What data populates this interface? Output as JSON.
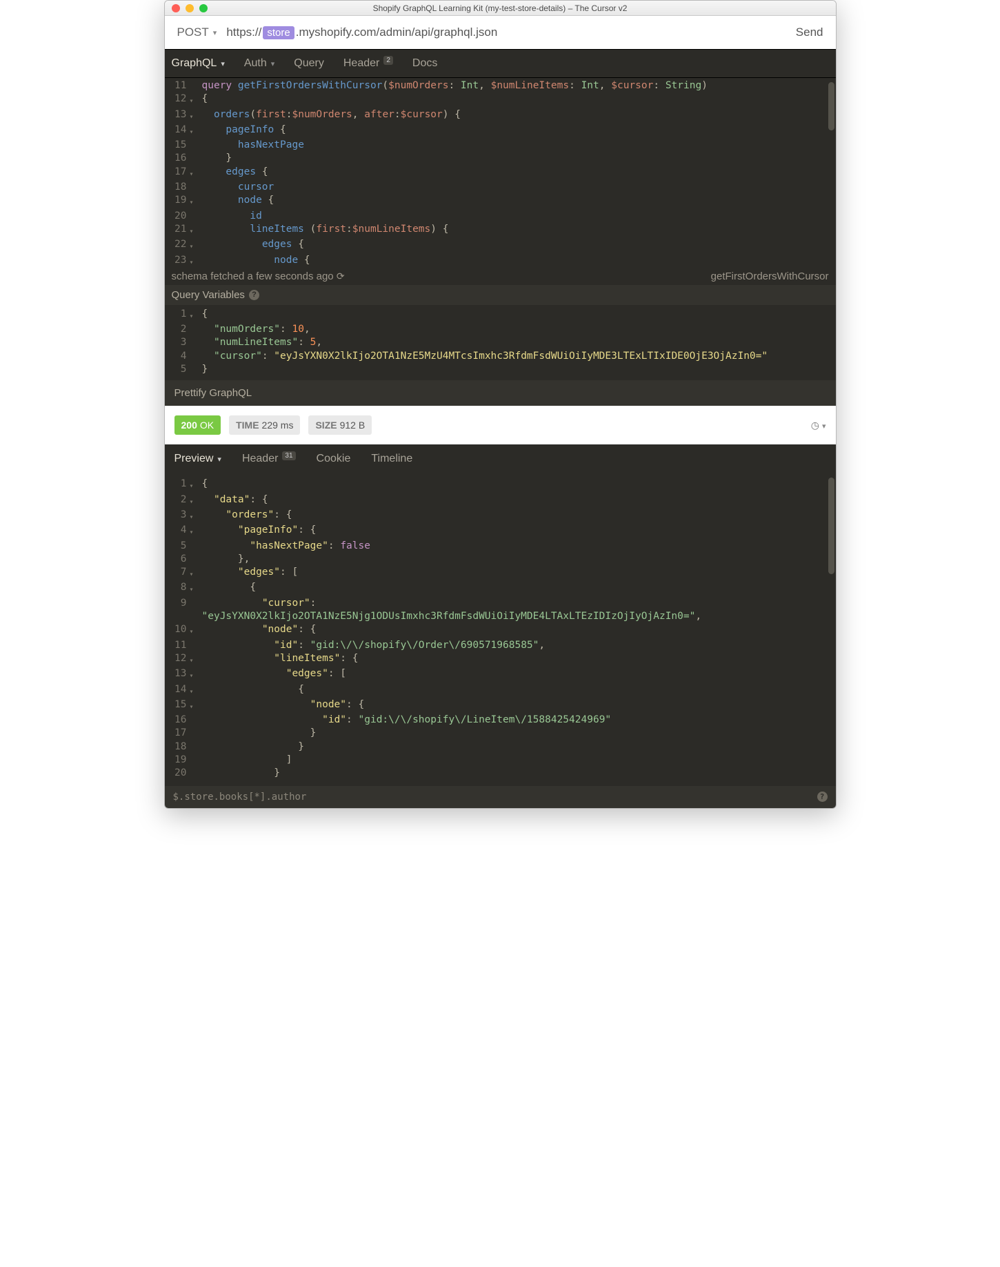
{
  "window": {
    "title": "Shopify GraphQL Learning Kit (my-test-store-details) – The Cursor v2"
  },
  "request": {
    "method": "POST",
    "url_prefix": "https://",
    "url_chip": "store",
    "url_suffix": ".myshopify.com/admin/api/graphql.json",
    "send_label": "Send"
  },
  "tabs": {
    "graphql": "GraphQL",
    "auth": "Auth",
    "query": "Query",
    "header": "Header",
    "header_badge": "2",
    "docs": "Docs"
  },
  "query_lines": [
    {
      "n": 11,
      "fold": "",
      "html": "<span class='kw-query'>query</span> <span class='kw-name'>getFirstOrdersWithCursor</span><span class='kw-punc'>(</span><span class='kw-var'>$numOrders</span><span class='kw-punc'>:</span> <span class='kw-type'>Int</span><span class='kw-punc'>,</span> <span class='kw-var'>$numLineItems</span><span class='kw-punc'>:</span> <span class='kw-type'>Int</span><span class='kw-punc'>,</span> <span class='kw-var'>$cursor</span><span class='kw-punc'>:</span> <span class='kw-type'>String</span><span class='kw-punc'>)</span>"
    },
    {
      "n": 12,
      "fold": "▾",
      "html": "<span class='kw-punc'>{</span>"
    },
    {
      "n": 13,
      "fold": "▾",
      "html": "  <span class='kw-field'>orders</span><span class='kw-punc'>(</span><span class='kw-arg'>first</span><span class='kw-punc'>:</span><span class='kw-var'>$numOrders</span><span class='kw-punc'>,</span> <span class='kw-arg'>after</span><span class='kw-punc'>:</span><span class='kw-var'>$cursor</span><span class='kw-punc'>) {</span>"
    },
    {
      "n": 14,
      "fold": "▾",
      "html": "    <span class='kw-field'>pageInfo</span> <span class='kw-punc'>{</span>"
    },
    {
      "n": 15,
      "fold": "",
      "html": "      <span class='kw-field'>hasNextPage</span>"
    },
    {
      "n": 16,
      "fold": "",
      "html": "    <span class='kw-punc'>}</span>"
    },
    {
      "n": 17,
      "fold": "▾",
      "html": "    <span class='kw-field'>edges</span> <span class='kw-punc'>{</span>"
    },
    {
      "n": 18,
      "fold": "",
      "html": "      <span class='kw-field'>cursor</span>"
    },
    {
      "n": 19,
      "fold": "▾",
      "html": "      <span class='kw-field'>node</span> <span class='kw-punc'>{</span>"
    },
    {
      "n": 20,
      "fold": "",
      "html": "        <span class='kw-field'>id</span>"
    },
    {
      "n": 21,
      "fold": "▾",
      "html": "        <span class='kw-field'>lineItems</span> <span class='kw-punc'>(</span><span class='kw-arg'>first</span><span class='kw-punc'>:</span><span class='kw-var'>$numLineItems</span><span class='kw-punc'>) {</span>"
    },
    {
      "n": 22,
      "fold": "▾",
      "html": "          <span class='kw-field'>edges</span> <span class='kw-punc'>{</span>"
    },
    {
      "n": 23,
      "fold": "▾",
      "html": "            <span class='kw-field'>node</span> <span class='kw-punc'>{</span>"
    }
  ],
  "schema_status": "schema fetched a few seconds ago",
  "current_op": "getFirstOrdersWithCursor",
  "vars_header": "Query Variables",
  "vars_lines": [
    {
      "n": 1,
      "fold": "▾",
      "html": "<span class='kw-punc'>{</span>"
    },
    {
      "n": 2,
      "fold": "",
      "html": "  <span class='kw-key'>\"numOrders\"</span><span class='kw-punc'>:</span> <span class='kw-num'>10</span><span class='kw-punc'>,</span>"
    },
    {
      "n": 3,
      "fold": "",
      "html": "  <span class='kw-key'>\"numLineItems\"</span><span class='kw-punc'>:</span> <span class='kw-num'>5</span><span class='kw-punc'>,</span>"
    },
    {
      "n": 4,
      "fold": "",
      "html": "  <span class='kw-key'>\"cursor\"</span><span class='kw-punc'>:</span> <span class='kw-str'>\"eyJsYXN0X2lkIjo2OTA1NzE5MzU4MTcsImxhc3RfdmFsdWUiOiIyMDE3LTExLTIxIDE0OjE3OjAzIn0=\"</span>"
    },
    {
      "n": 5,
      "fold": "",
      "html": "<span class='kw-punc'>}</span>"
    }
  ],
  "prettify": "Prettify GraphQL",
  "status": {
    "code": "200",
    "text": "OK",
    "time_label": "TIME",
    "time_value": "229 ms",
    "size_label": "SIZE",
    "size_value": "912 B"
  },
  "resp_tabs": {
    "preview": "Preview",
    "header": "Header",
    "header_badge": "31",
    "cookie": "Cookie",
    "timeline": "Timeline"
  },
  "resp_lines": [
    {
      "n": 1,
      "fold": "▾",
      "html": "<span class='kw-punc'>{</span>"
    },
    {
      "n": 2,
      "fold": "▾",
      "html": "  <span class='kw-key'>\"data\"</span><span class='kw-punc'>: {</span>"
    },
    {
      "n": 3,
      "fold": "▾",
      "html": "    <span class='kw-key'>\"orders\"</span><span class='kw-punc'>: {</span>"
    },
    {
      "n": 4,
      "fold": "▾",
      "html": "      <span class='kw-key'>\"pageInfo\"</span><span class='kw-punc'>: {</span>"
    },
    {
      "n": 5,
      "fold": "",
      "html": "        <span class='kw-key'>\"hasNextPage\"</span><span class='kw-punc'>:</span> <span class='kw-bool'>false</span>"
    },
    {
      "n": 6,
      "fold": "",
      "html": "      <span class='kw-punc'>},</span>"
    },
    {
      "n": 7,
      "fold": "▾",
      "html": "      <span class='kw-key'>\"edges\"</span><span class='kw-punc'>: [</span>"
    },
    {
      "n": 8,
      "fold": "▾",
      "html": "        <span class='kw-punc'>{</span>"
    },
    {
      "n": 9,
      "fold": "",
      "html": "          <span class='kw-key'>\"cursor\"</span><span class='kw-punc'>:</span>"
    },
    {
      "n": "",
      "fold": "",
      "html": "<span class='kw-str'>\"eyJsYXN0X2lkIjo2OTA1NzE5Njg1ODUsImxhc3RfdmFsdWUiOiIyMDE4LTAxLTEzIDIzOjIyOjAzIn0=\"</span><span class='kw-punc'>,</span>"
    },
    {
      "n": 10,
      "fold": "▾",
      "html": "          <span class='kw-key'>\"node\"</span><span class='kw-punc'>: {</span>"
    },
    {
      "n": 11,
      "fold": "",
      "html": "            <span class='kw-key'>\"id\"</span><span class='kw-punc'>:</span> <span class='kw-str'>\"gid:\\/\\/shopify\\/Order\\/690571968585\"</span><span class='kw-punc'>,</span>"
    },
    {
      "n": 12,
      "fold": "▾",
      "html": "            <span class='kw-key'>\"lineItems\"</span><span class='kw-punc'>: {</span>"
    },
    {
      "n": 13,
      "fold": "▾",
      "html": "              <span class='kw-key'>\"edges\"</span><span class='kw-punc'>: [</span>"
    },
    {
      "n": 14,
      "fold": "▾",
      "html": "                <span class='kw-punc'>{</span>"
    },
    {
      "n": 15,
      "fold": "▾",
      "html": "                  <span class='kw-key'>\"node\"</span><span class='kw-punc'>: {</span>"
    },
    {
      "n": 16,
      "fold": "",
      "html": "                    <span class='kw-key'>\"id\"</span><span class='kw-punc'>:</span> <span class='kw-str'>\"gid:\\/\\/shopify\\/LineItem\\/1588425424969\"</span>"
    },
    {
      "n": 17,
      "fold": "",
      "html": "                  <span class='kw-punc'>}</span>"
    },
    {
      "n": 18,
      "fold": "",
      "html": "                <span class='kw-punc'>}</span>"
    },
    {
      "n": 19,
      "fold": "",
      "html": "              <span class='kw-punc'>]</span>"
    },
    {
      "n": 20,
      "fold": "",
      "html": "            <span class='kw-punc'>}</span>"
    }
  ],
  "footer": {
    "jsonpath": "$.store.books[*].author"
  }
}
